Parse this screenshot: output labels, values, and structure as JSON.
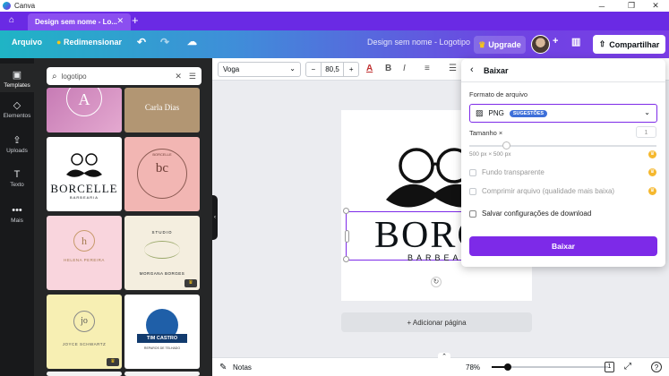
{
  "window": {
    "title": "Canva",
    "minimize": "─",
    "maximize": "❐",
    "close": "✕"
  },
  "browser": {
    "tab_title": "Design sem nome - Lo...",
    "tab_close": "✕",
    "new_tab": "+"
  },
  "header": {
    "file_label": "Arquivo",
    "resize_label": "Redimensionar",
    "design_title": "Design sem nome - Logotipo",
    "upgrade_label": "Upgrade",
    "share_label": "Compartilhar"
  },
  "rail": {
    "items": [
      {
        "label": "Templates",
        "icon": "▣"
      },
      {
        "label": "Elementos",
        "icon": "◇"
      },
      {
        "label": "Uploads",
        "icon": "⇪"
      },
      {
        "label": "Texto",
        "icon": "T"
      },
      {
        "label": "Mais",
        "icon": "•••"
      }
    ]
  },
  "panel": {
    "search_value": "logotipo",
    "thumbs": [
      {
        "text": "A",
        "sub": ""
      },
      {
        "text": "Carla Dias",
        "sub": ""
      },
      {
        "text": "BORCELLE",
        "sub": "BARBEARIA"
      },
      {
        "text": "bc",
        "sub": "BORCELLE"
      },
      {
        "text": "h",
        "sub": "HELENA PEREIRA"
      },
      {
        "text": "STUDIO",
        "sub": "MORGANA BORGES"
      },
      {
        "text": "jo",
        "sub": "JOYCE SCHWARTZ"
      },
      {
        "text": "TIM CASTRO",
        "sub": "REPAROS DE TELHADO"
      }
    ]
  },
  "toolbar": {
    "font": "Voga",
    "font_size": "80,5",
    "minus": "−",
    "plus": "+"
  },
  "canvas": {
    "logo_main": "BORCELLE",
    "logo_sub": "BARBEARIA",
    "add_page": "+ Adicionar página"
  },
  "footer": {
    "notes_label": "Notas",
    "zoom": "78%",
    "page_count": "1",
    "help": "?"
  },
  "download": {
    "title": "Baixar",
    "format_label": "Formato de arquivo",
    "format_value": "PNG",
    "format_badge": "SUGESTÕES",
    "size_label": "Tamanho ×",
    "size_value": "1",
    "size_dims": "500 px × 500 px",
    "options": [
      {
        "label": "Fundo transparente",
        "enabled": false,
        "pro": true
      },
      {
        "label": "Comprimir arquivo (qualidade mais baixa)",
        "enabled": false,
        "pro": true
      },
      {
        "label": "Salvar configurações de download",
        "enabled": true,
        "pro": false
      }
    ],
    "button_label": "Baixar"
  }
}
